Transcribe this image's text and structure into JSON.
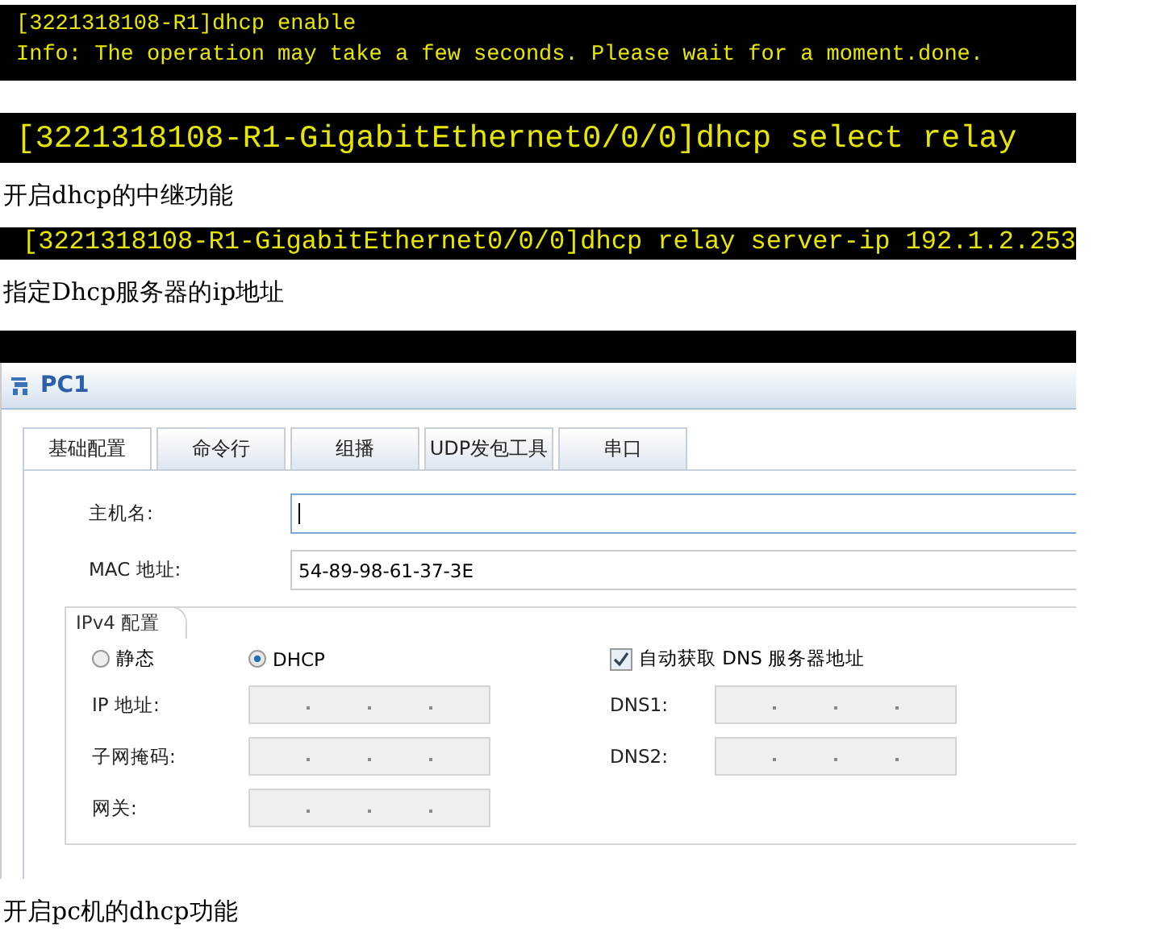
{
  "blocks": [
    {
      "kind": "terminal",
      "lines": [
        "[3221318108-R1]dhcp enable",
        "Info: The operation may take a few seconds. Please wait for a moment.done."
      ]
    },
    {
      "kind": "terminal",
      "lines": [
        "[3221318108-R1-GigabitEthernet0/0/0]dhcp select relay"
      ]
    },
    {
      "kind": "caption",
      "text": "开启dhcp的中继功能"
    },
    {
      "kind": "terminal",
      "lines": [
        "[3221318108-R1-GigabitEthernet0/0/0]dhcp relay server-ip 192.1.2.253"
      ]
    },
    {
      "kind": "caption",
      "text": "指定Dhcp服务器的ip地址"
    },
    {
      "kind": "bar"
    },
    {
      "kind": "window",
      "title": "PC1",
      "tabs": [
        {
          "label": "基础配置",
          "selected": true
        },
        {
          "label": "命令行",
          "selected": false
        },
        {
          "label": "组播",
          "selected": false
        },
        {
          "label": "UDP发包工具",
          "selected": false
        },
        {
          "label": "串口",
          "selected": false
        }
      ],
      "hostname": {
        "label": "主机名:",
        "focused": true
      },
      "mac": {
        "label": "MAC 地址:",
        "value": "54-89-98-61-37-3E"
      },
      "ipv4": {
        "title": "IPv4 配置",
        "modes": [
          {
            "label": "静态",
            "selected": false
          },
          {
            "label": "DHCP",
            "selected": true
          }
        ],
        "auto_dns": {
          "label": "自动获取 DNS 服务器地址",
          "checked": true
        },
        "left_fields": [
          {
            "label": "IP 地址:",
            "disabled": true
          },
          {
            "label": "子网掩码:",
            "disabled": true
          },
          {
            "label": "网关:",
            "disabled": true
          }
        ],
        "right_fields": [
          {
            "label": "DNS1:",
            "disabled": true
          },
          {
            "label": "DNS2:",
            "disabled": true
          }
        ]
      }
    },
    {
      "kind": "caption",
      "text": "开启pc机的dhcp功能"
    }
  ]
}
